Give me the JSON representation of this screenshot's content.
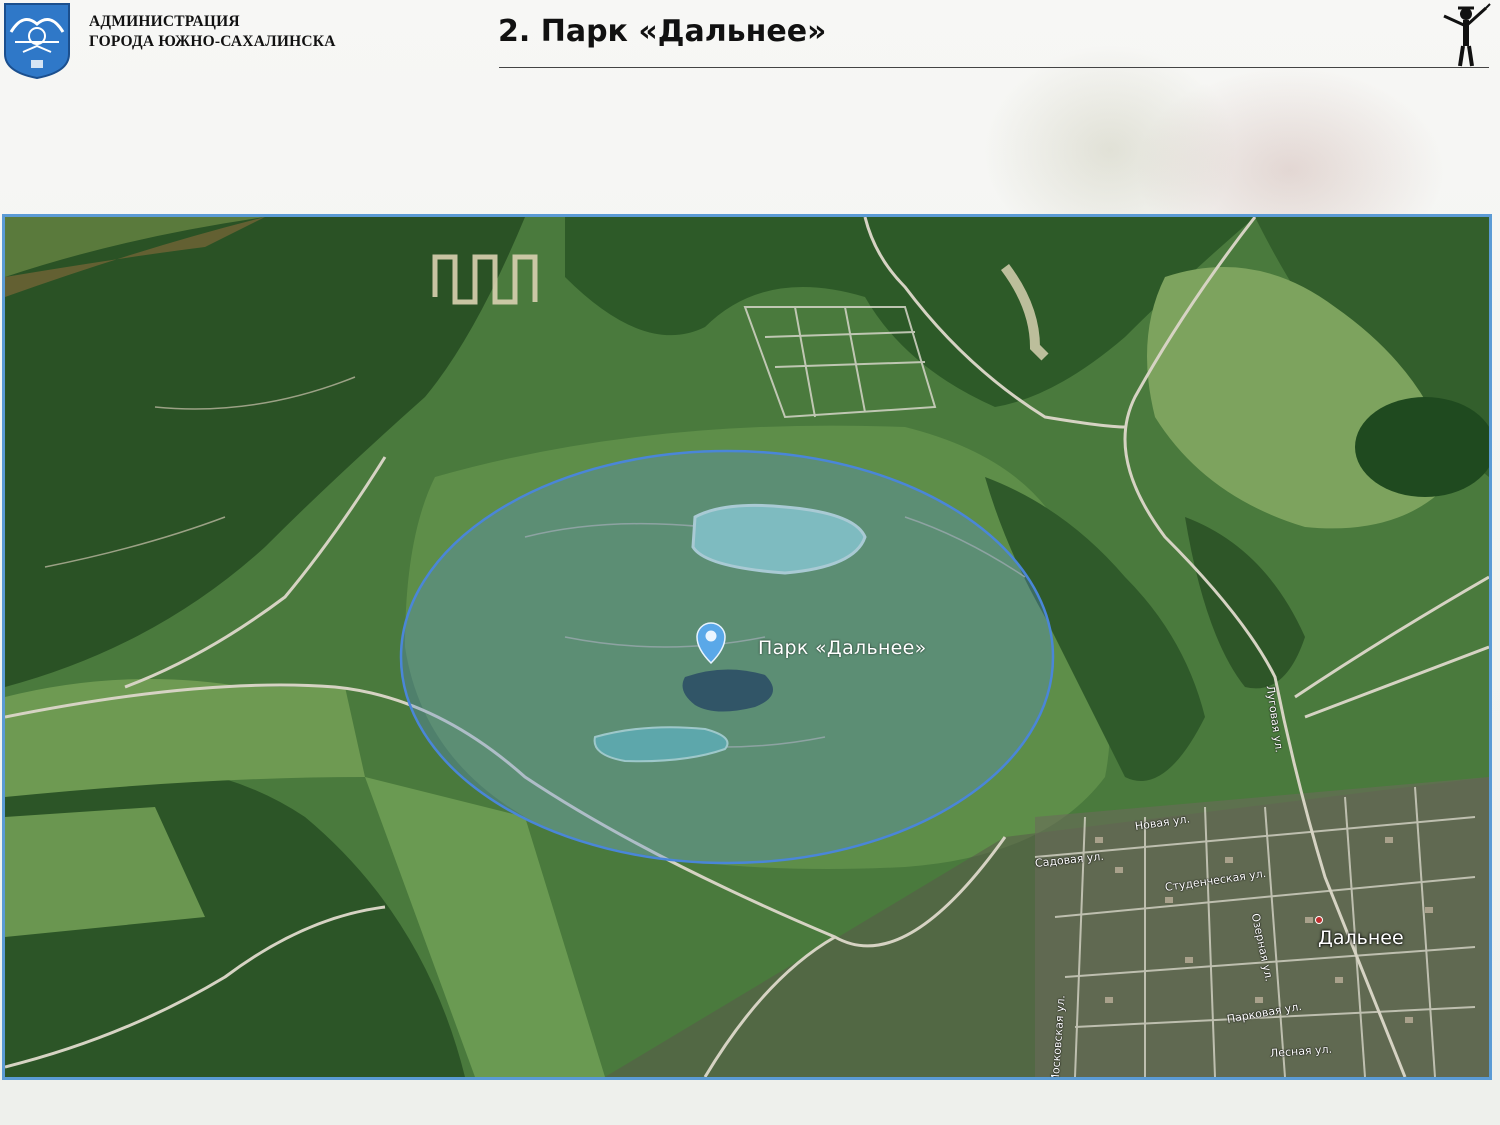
{
  "header": {
    "org_line1": "АДМИНИСТРАЦИЯ",
    "org_line2": "ГОРОДА ЮЖНО-САХАЛИНСКА",
    "slide_title": "2. Парк «Дальнее»"
  },
  "map": {
    "view": "satellite",
    "marker_label": "Парк «Дальнее»",
    "village_label": "Дальнее",
    "streets": [
      "Новая ул.",
      "Садовая ул.",
      "Студенческая ул.",
      "Озерная ул.",
      "Парковая ул.",
      "Московская ул.",
      "Лесная ул.",
      "Луговая ул."
    ]
  },
  "colors": {
    "frame_border": "#5b9bd5",
    "circle_fill": "#5a8fcf",
    "marker": "#5aa8e8",
    "forest": "#2f5a2a",
    "meadow": "#6d9a56"
  }
}
